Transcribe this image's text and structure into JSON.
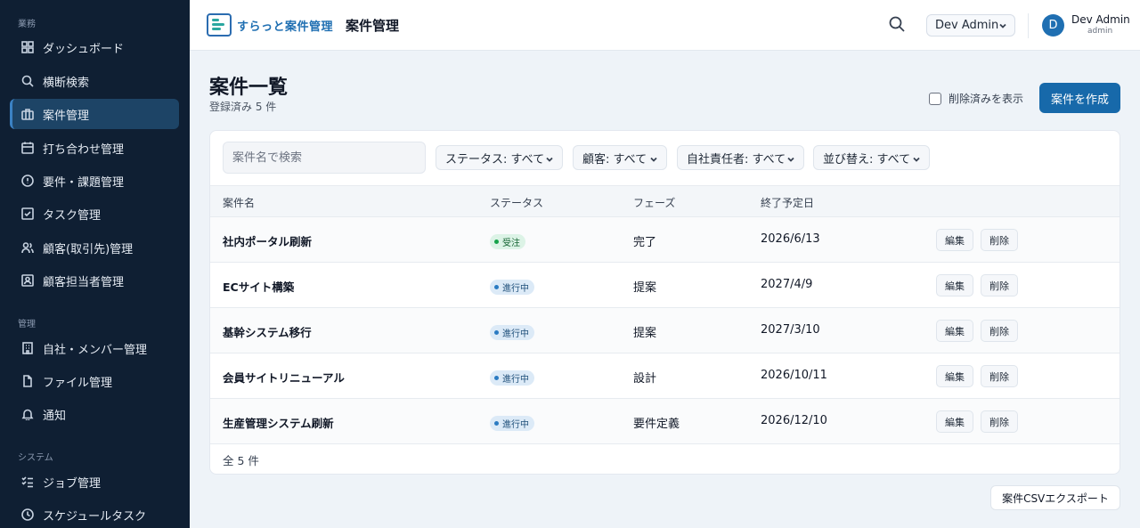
{
  "app": {
    "logo_text": "すらっと案件管理",
    "header_title": "案件管理"
  },
  "header": {
    "tenant": "Dev Admin",
    "user": {
      "initial": "D",
      "name": "Dev Admin",
      "role": "admin"
    }
  },
  "sidebar": {
    "sections": [
      {
        "label": "業務",
        "items": [
          {
            "label": "ダッシュボード",
            "icon": "dashboard-icon"
          },
          {
            "label": "横断検索",
            "icon": "search-icon"
          },
          {
            "label": "案件管理",
            "icon": "briefcase-icon",
            "active": true
          },
          {
            "label": "打ち合わせ管理",
            "icon": "calendar-icon"
          },
          {
            "label": "要件・課題管理",
            "icon": "alert-circle-icon"
          },
          {
            "label": "タスク管理",
            "icon": "checkbox-icon"
          },
          {
            "label": "顧客(取引先)管理",
            "icon": "users-icon"
          },
          {
            "label": "顧客担当者管理",
            "icon": "contact-card-icon"
          }
        ]
      },
      {
        "label": "管理",
        "items": [
          {
            "label": "自社・メンバー管理",
            "icon": "building-icon"
          },
          {
            "label": "ファイル管理",
            "icon": "file-icon"
          },
          {
            "label": "通知",
            "icon": "bell-icon"
          }
        ]
      },
      {
        "label": "システム",
        "items": [
          {
            "label": "ジョブ管理",
            "icon": "list-check-icon"
          },
          {
            "label": "スケジュールタスク",
            "icon": "clock-icon"
          }
        ]
      }
    ]
  },
  "page": {
    "title": "案件一覧",
    "subtitle": "登録済み 5 件",
    "show_deleted_label": "削除済みを表示",
    "create_label": "案件を作成",
    "export_label": "案件CSVエクスポート"
  },
  "filters": {
    "search_placeholder": "案件名で検索",
    "status": "ステータス: すべて",
    "customer": "顧客: すべて",
    "owner": "自社責任者: すべて",
    "sort": "並び替え: すべて"
  },
  "table": {
    "columns": [
      "案件名",
      "ステータス",
      "フェーズ",
      "終了予定日"
    ],
    "edit_label": "編集",
    "delete_label": "削除",
    "rows": [
      {
        "name": "社内ポータル刷新",
        "status": "受注",
        "status_kind": "won",
        "phase": "完了",
        "end_date": "2026/6/13"
      },
      {
        "name": "ECサイト構築",
        "status": "進行中",
        "status_kind": "prog",
        "phase": "提案",
        "end_date": "2027/4/9"
      },
      {
        "name": "基幹システム移行",
        "status": "進行中",
        "status_kind": "prog",
        "phase": "提案",
        "end_date": "2027/3/10"
      },
      {
        "name": "会員サイトリニューアル",
        "status": "進行中",
        "status_kind": "prog",
        "phase": "設計",
        "end_date": "2026/10/11"
      },
      {
        "name": "生産管理システム刷新",
        "status": "進行中",
        "status_kind": "prog",
        "phase": "要件定義",
        "end_date": "2026/12/10"
      }
    ],
    "total_label": "全 5 件"
  },
  "colors": {
    "sidebar_bg": "#0f1f33",
    "accent": "#1769aa",
    "won": "#16a34a",
    "progress": "#2b7bc2"
  }
}
